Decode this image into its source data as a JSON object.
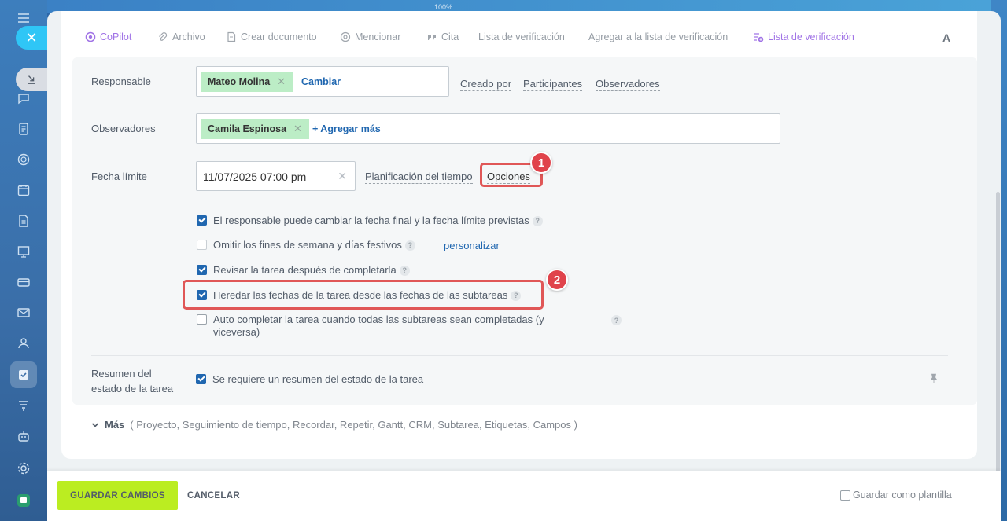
{
  "background": {
    "zoom_label": "100%"
  },
  "toolbar": {
    "copilot": "CoPilot",
    "file": "Archivo",
    "create_document": "Crear documento",
    "mention": "Mencionar",
    "quote": "Cita",
    "checklist": "Lista de verificación",
    "add_to_checklist": "Agregar a la lista de verificación",
    "checklist_new": "Lista de verificación",
    "font": "A"
  },
  "responsible": {
    "label": "Responsable",
    "person": "Mateo Molina",
    "change": "Cambiar",
    "links": [
      "Creado por",
      "Participantes",
      "Observadores"
    ]
  },
  "observers": {
    "label": "Observadores",
    "person": "Camila Espinosa",
    "add_more": "+ Agregar más"
  },
  "deadline": {
    "label": "Fecha límite",
    "value": "11/07/2025 07:00 pm",
    "time_planning": "Planificación del tiempo",
    "options": "Opciones",
    "badge1": "1",
    "badge2": "2",
    "options_list": [
      {
        "text": "El responsable puede cambiar la fecha final y la fecha límite previstas",
        "checked": true
      },
      {
        "text": "Omitir los fines de semana y días festivos",
        "checked": false,
        "extra": "personalizar"
      },
      {
        "text": "Revisar la tarea después de completarla",
        "checked": true
      },
      {
        "text": "Heredar las fechas de la tarea desde las fechas de las subtareas",
        "checked": true
      },
      {
        "text": "Auto completar la tarea cuando todas las subtareas sean completadas (y viceversa)",
        "checked": false
      }
    ]
  },
  "summary": {
    "label_line1": "Resumen del",
    "label_line2": "estado de la tarea",
    "option": "Se requiere un resumen del estado de la tarea",
    "checked": true
  },
  "more": {
    "title": "Más",
    "items": "( Proyecto,  Seguimiento de tiempo,  Recordar,  Repetir,  Gantt,  CRM,  Subtarea,  Etiquetas,  Campos )"
  },
  "footer": {
    "save": "GUARDAR CAMBIOS",
    "cancel": "CANCELAR",
    "save_template": "Guardar como plantilla"
  },
  "colors": {
    "accent_green": "#bbed21",
    "link_blue": "#2067b0",
    "chip_green": "#bcedc6",
    "highlight_red": "#e05757",
    "copilot_purple": "#a174e6"
  }
}
